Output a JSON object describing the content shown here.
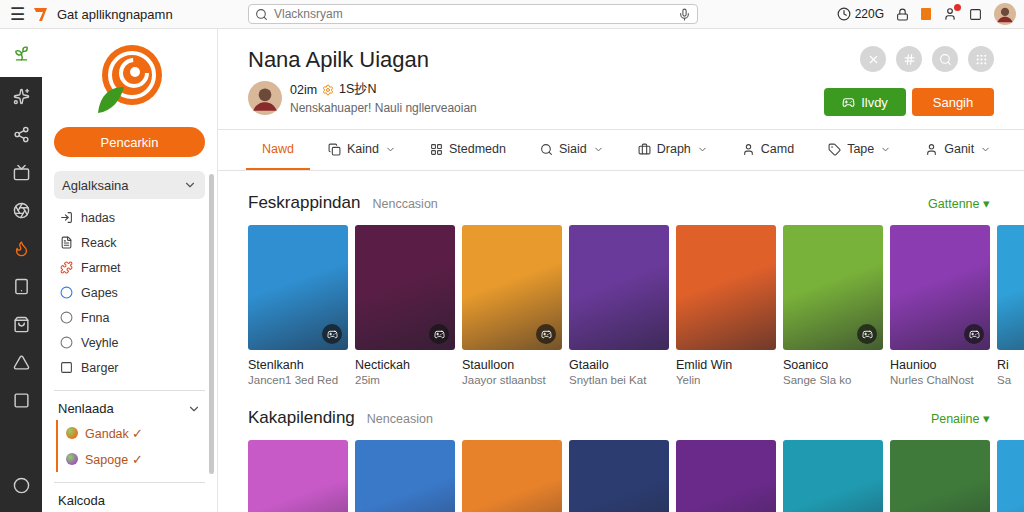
{
  "topbar": {
    "menu": "☰",
    "title": "Gat apllikngnapamn",
    "search": {
      "placeholder": "Vlacknsryam"
    },
    "time": "220G",
    "notification": true
  },
  "sidebar": {
    "button": "Pencarkin",
    "dropdown": {
      "label": "Aglalksaina",
      "expanded": false
    },
    "items": [
      {
        "label": "hadas"
      },
      {
        "label": "Reack"
      },
      {
        "label": "Farmet"
      },
      {
        "label": "Gapes"
      },
      {
        "label": "Fnna"
      },
      {
        "label": "Veyhle"
      },
      {
        "label": "Barger"
      }
    ],
    "section": {
      "title": "Nenlaada",
      "expanded": true,
      "items": [
        {
          "label": "Gandak ✓",
          "color": "#e8731a"
        },
        {
          "label": "Sapoge ✓",
          "color": "#9b59b6"
        }
      ]
    },
    "footer_section": {
      "title": "Kalcoda"
    }
  },
  "header": {
    "title": "Nana Apilk Uiagan",
    "meta": "02im",
    "meta_extra": "1S抄N",
    "subtitle": "Nenskahuaper! Nauli ngllerveaoian",
    "buttons": [
      {
        "label": "Ilvdy",
        "kind": "primary"
      },
      {
        "label": "Sangih",
        "kind": "accent"
      }
    ]
  },
  "tabs": [
    {
      "label": "Nawd",
      "selected": true,
      "dropdown": false
    },
    {
      "label": "Kaind",
      "selected": false,
      "dropdown": true
    },
    {
      "label": "Stedmedn",
      "selected": false,
      "dropdown": false
    },
    {
      "label": "Siaid",
      "selected": false,
      "dropdown": true
    },
    {
      "label": "Draph",
      "selected": false,
      "dropdown": true
    },
    {
      "label": "Camd",
      "selected": false,
      "dropdown": false
    },
    {
      "label": "Tape",
      "selected": false,
      "dropdown": true
    },
    {
      "label": "Ganit",
      "selected": false,
      "dropdown": true
    }
  ],
  "sections": [
    {
      "title": "Feskrappindan",
      "subtitle": "Nenccasion",
      "action": "Gattenne ▾",
      "cards": [
        {
          "title": "Stenlkanh",
          "subtitle": "Jancen1 3ed Red",
          "color": "#2f8fd0",
          "badge": true
        },
        {
          "title": "Nectickah",
          "subtitle": "25im",
          "color": "#5a1e46",
          "badge": true
        },
        {
          "title": "Staulloon",
          "subtitle": "Jaayor stlaanbst",
          "color": "#e89a2c",
          "badge": true
        },
        {
          "title": "Gtaailo",
          "subtitle": "Snytlan bei Kat",
          "color": "#6a3a9a",
          "badge": false
        },
        {
          "title": "Emlid Win",
          "subtitle": "Yelin",
          "color": "#e0602a",
          "badge": false
        },
        {
          "title": "Soanico",
          "subtitle": "Sange Sla ko",
          "color": "#79b23a",
          "badge": true
        },
        {
          "title": "Haunioo",
          "subtitle": "Nurles ChalNost",
          "color": "#8a3cb0",
          "badge": true
        },
        {
          "title": "Ri",
          "subtitle": "Sa",
          "color": "#2fa0d8",
          "badge": false
        }
      ]
    },
    {
      "title": "Kakapilending",
      "subtitle": "Nenceasion",
      "action": "Penaiine ▾",
      "cards": [
        {
          "color": "#c85ac8",
          "badge": false
        },
        {
          "color": "#3a78c8",
          "badge": false
        },
        {
          "color": "#e8822a",
          "badge": false
        },
        {
          "color": "#2c3c70",
          "badge": false
        },
        {
          "color": "#6a2a8a",
          "badge": false
        },
        {
          "color": "#1f9ab0",
          "badge": false
        },
        {
          "color": "#3f7a3a",
          "badge": false
        },
        {
          "color": "#2fa0d8",
          "badge": false
        }
      ]
    }
  ]
}
